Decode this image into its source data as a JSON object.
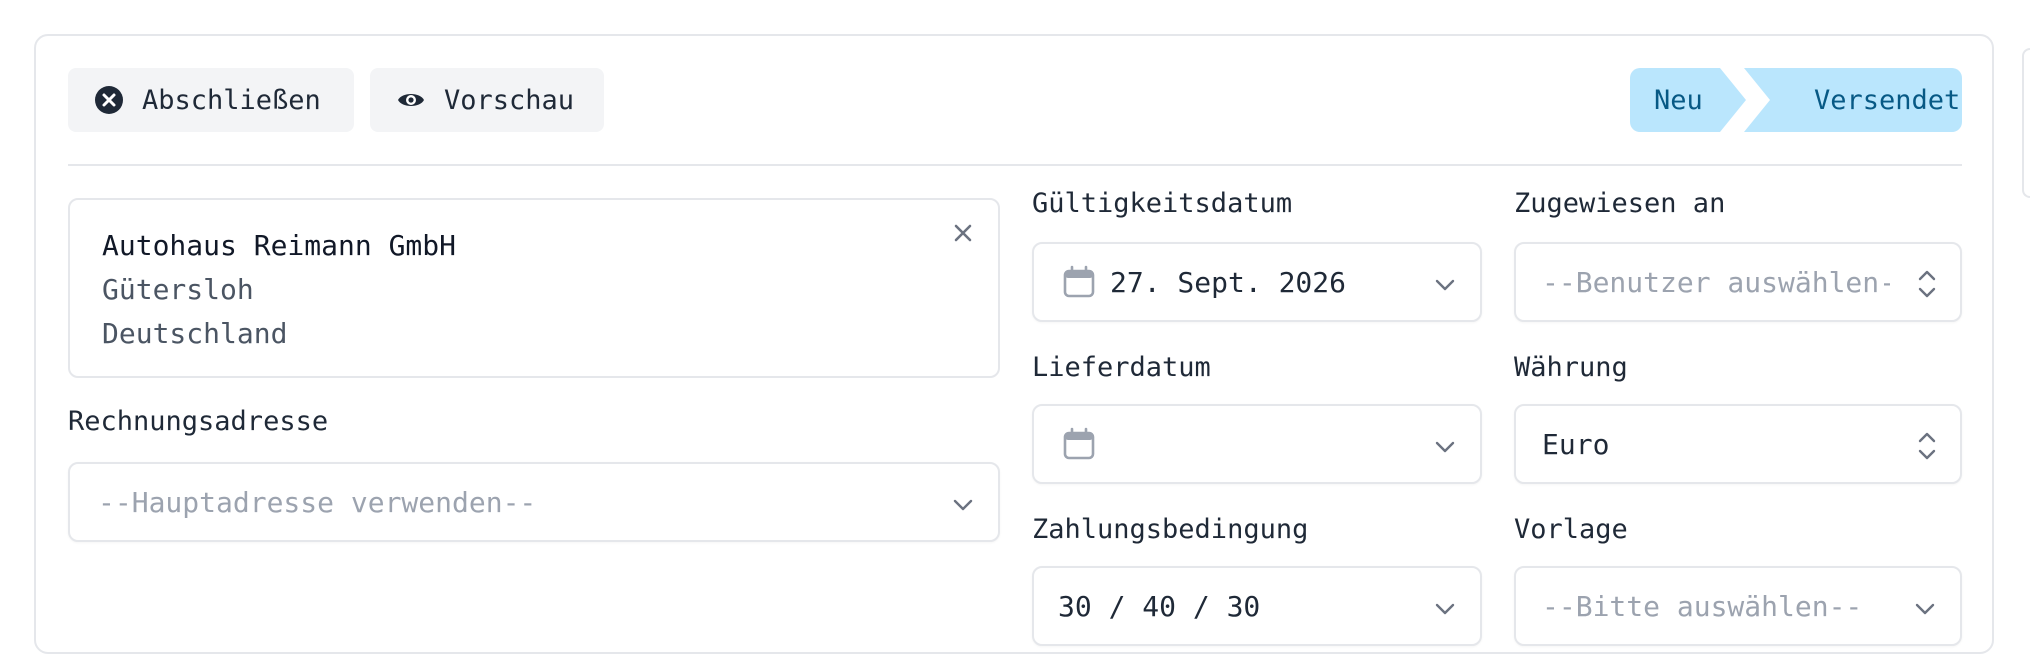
{
  "toolbar": {
    "close_label": "Abschließen",
    "preview_label": "Vorschau"
  },
  "status_steps": [
    "Neu",
    "Versendet"
  ],
  "customer": {
    "name": "Autohaus Reimann GmbH",
    "city": "Gütersloh",
    "country": "Deutschland"
  },
  "billing_address": {
    "label": "Rechnungsadresse",
    "placeholder": "--Hauptadresse verwenden--"
  },
  "validity_date": {
    "label": "Gültigkeitsdatum",
    "value": "27. Sept. 2026"
  },
  "assigned_to": {
    "label": "Zugewiesen an",
    "placeholder": "--Benutzer auswählen--"
  },
  "delivery_date": {
    "label": "Lieferdatum",
    "value": ""
  },
  "currency": {
    "label": "Währung",
    "value": "Euro"
  },
  "payment_terms": {
    "label": "Zahlungsbedingung",
    "value": "30 / 40 / 30"
  },
  "template": {
    "label": "Vorlage",
    "placeholder": "--Bitte auswählen--"
  },
  "colors": {
    "step_bg": "#bae6fd",
    "step_text": "#075985",
    "border": "#e5e7eb",
    "placeholder": "#9ca3af"
  }
}
